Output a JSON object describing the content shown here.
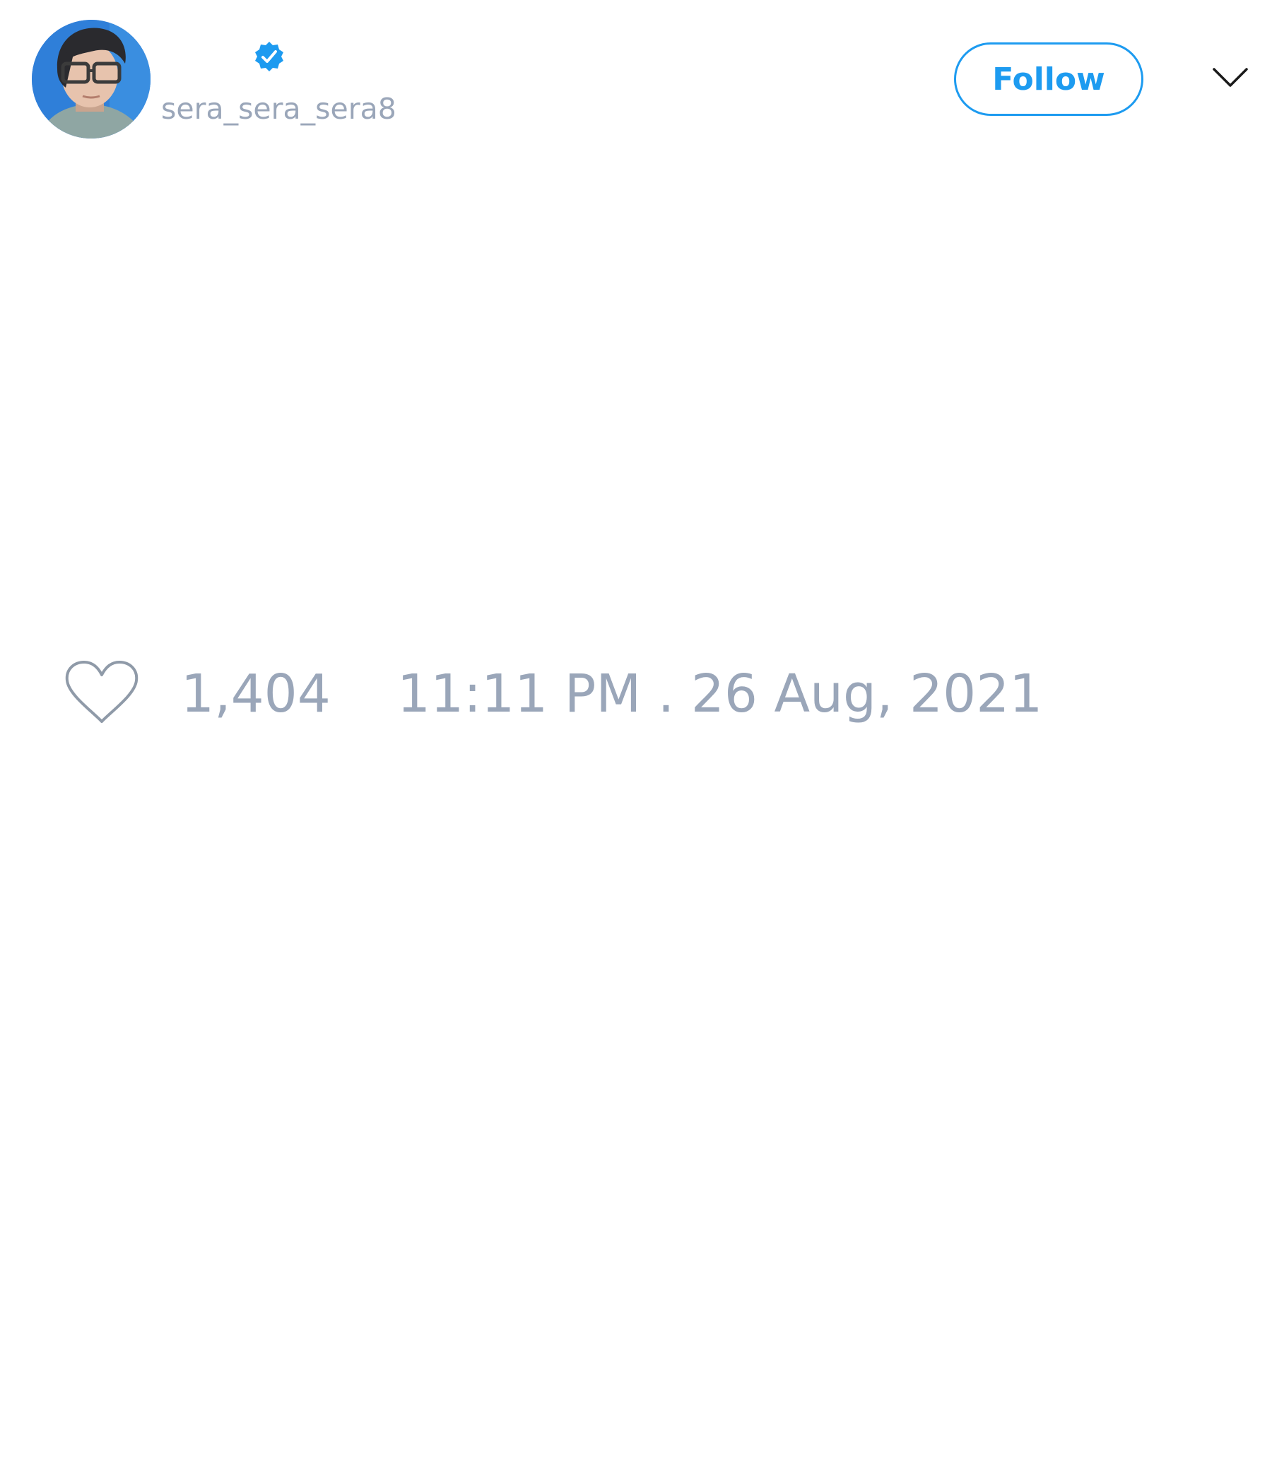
{
  "tweet": {
    "author": {
      "handle": "sera_sera_sera8",
      "verified": true,
      "avatar_icon": "user-avatar-photo"
    },
    "follow_label": "Follow",
    "menu_icon": "chevron-down-icon",
    "likes": {
      "icon": "heart-icon",
      "count": "1,404"
    },
    "timestamp": "11:11 PM . 26 Aug, 2021"
  },
  "colors": {
    "accent": "#1d9bf0",
    "muted_text": "#9aa6b9",
    "background": "#ffffff"
  }
}
